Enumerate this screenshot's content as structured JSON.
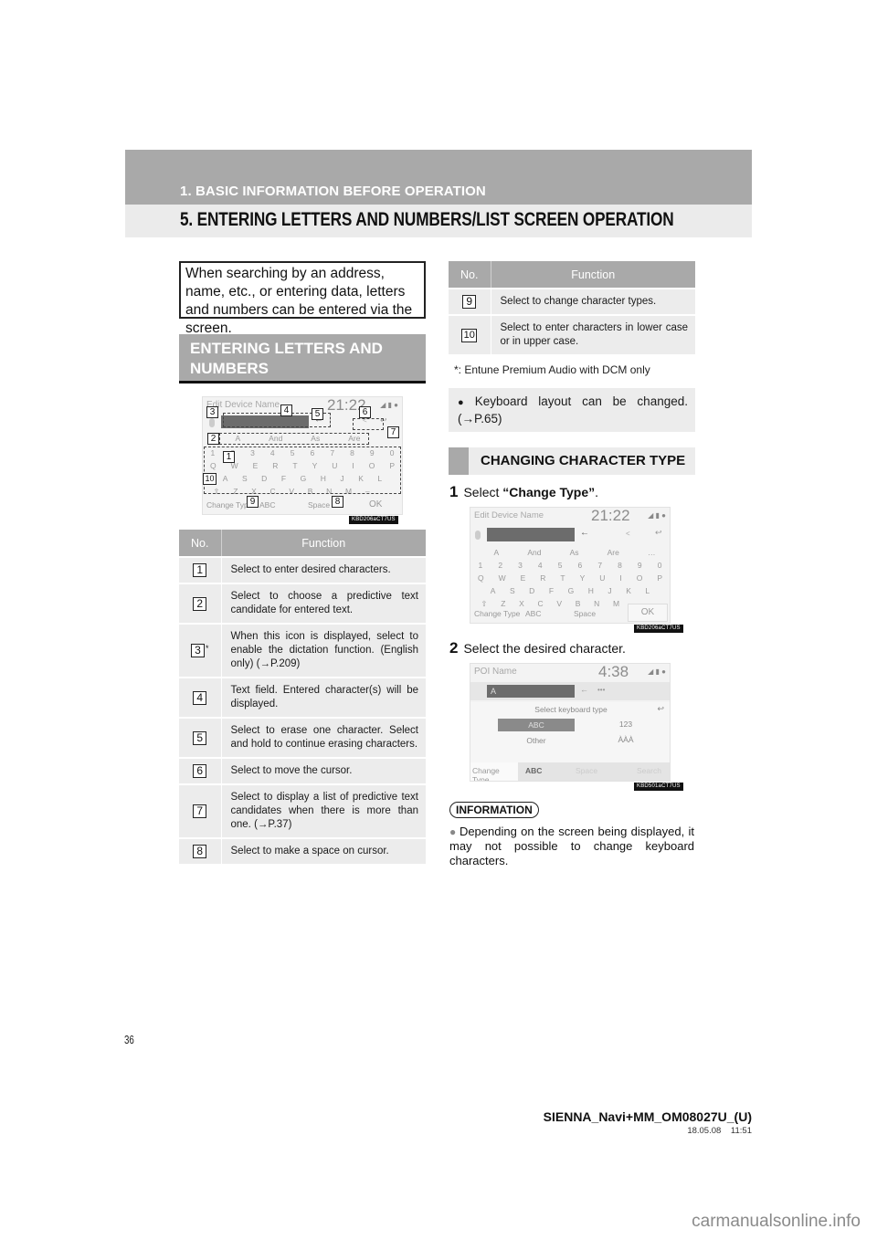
{
  "header": {
    "section": "1. BASIC INFORMATION BEFORE OPERATION",
    "title": "5. ENTERING LETTERS AND NUMBERS/LIST SCREEN OPERATION"
  },
  "intro": "When searching by an address, name, etc., or entering data, letters and numbers can be entered via the screen.",
  "section_entering": "ENTERING LETTERS AND NUMBERS",
  "screen_edit": {
    "title": "Edit Device Name",
    "time": "21:22",
    "status": "◢ ▮ ●",
    "backspace": "←",
    "cursor_left": "<",
    "cursor_right": "›",
    "return": "↩",
    "more": "…",
    "predictive": [
      "A",
      "And",
      "As",
      "Are"
    ],
    "rows": [
      [
        "1",
        "2",
        "3",
        "4",
        "5",
        "6",
        "7",
        "8",
        "9",
        "0"
      ],
      [
        "Q",
        "W",
        "E",
        "R",
        "T",
        "Y",
        "U",
        "I",
        "O",
        "P"
      ],
      [
        "A",
        "S",
        "D",
        "F",
        "G",
        "H",
        "J",
        "K",
        "L"
      ],
      [
        "⇧",
        "Z",
        "X",
        "C",
        "V",
        "B",
        "N",
        "M",
        "–"
      ]
    ],
    "change_type": "Change Type",
    "abc": "ABC",
    "space": "Space",
    "ok": "OK",
    "code": "KBD206aCT7US"
  },
  "callouts": [
    "1",
    "2",
    "3",
    "4",
    "5",
    "6",
    "7",
    "8",
    "9",
    "10"
  ],
  "table_headers": {
    "no": "No.",
    "function": "Function"
  },
  "table_left": [
    {
      "no": "1",
      "text": "Select to enter desired characters."
    },
    {
      "no": "2",
      "text": "Select to choose a predictive text candidate for entered text."
    },
    {
      "no": "3",
      "star": "*",
      "text": "When this icon is displayed, select to enable the dictation function. (English only) (→P.209)"
    },
    {
      "no": "4",
      "text": "Text field. Entered character(s) will be displayed."
    },
    {
      "no": "5",
      "text": "Select to erase one character. Select and hold to continue erasing characters."
    },
    {
      "no": "6",
      "text": "Select to move the cursor."
    },
    {
      "no": "7",
      "text": "Select to display a list of predictive text candidates when there is more than one. (→P.37)"
    },
    {
      "no": "8",
      "text": "Select to make a space on cursor."
    }
  ],
  "table_right": [
    {
      "no": "9",
      "text": "Select to change character types."
    },
    {
      "no": "10",
      "text": "Select to enter characters in lower case or in upper case."
    }
  ],
  "footnote": "*: Entune Premium Audio with DCM only",
  "bullet_note": "Keyboard layout can be changed. (→P.65)",
  "section_changing": "CHANGING CHARACTER TYPE",
  "steps": [
    {
      "num": "1",
      "prefix": "Select ",
      "bold": "“Change Type”",
      "suffix": "."
    },
    {
      "num": "2",
      "prefix": "Select the desired character.",
      "bold": "",
      "suffix": ""
    }
  ],
  "screen_poi": {
    "title": "POI Name",
    "time": "4:38",
    "status": "◢ ▮ ●",
    "field_value": "A",
    "backspace": "←",
    "dots": "•••",
    "popup_title": "Select keyboard type",
    "return": "↩",
    "options": [
      "ABC",
      "123",
      "Other",
      "ÀÀÀ"
    ],
    "selected_option": "ABC",
    "change_type": "Change Type",
    "abc": "ABC",
    "space": "Space",
    "search": "Search",
    "code": "KBD501aCT7US"
  },
  "information": {
    "label": "INFORMATION",
    "text": "Depending on the screen being displayed, it may not possible to change keyboard characters."
  },
  "footer": {
    "page": "36",
    "doc_id": "SIENNA_Navi+MM_OM08027U_(U)",
    "date": "18.05.08    11:51",
    "watermark": "carmanualsonline.info"
  }
}
